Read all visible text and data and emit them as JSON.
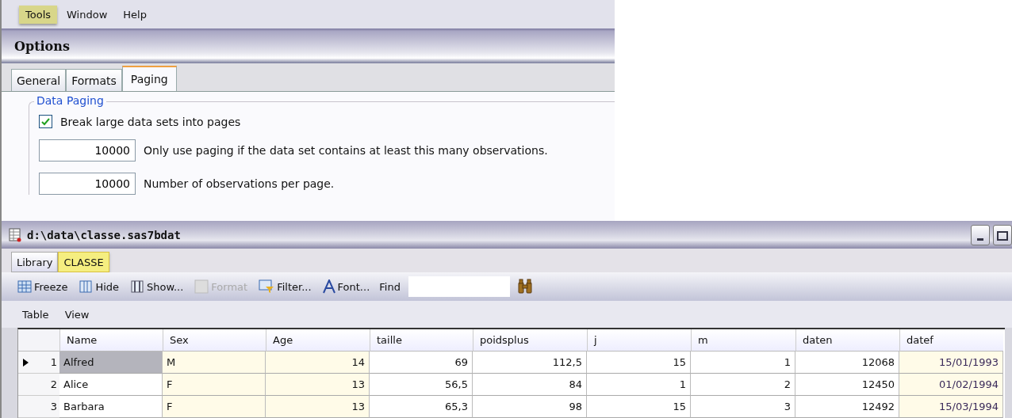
{
  "menu": [
    {
      "label": "Tools",
      "selected": true
    },
    {
      "label": "Window",
      "selected": false
    },
    {
      "label": "Help",
      "selected": false
    }
  ],
  "options": {
    "title": "Options",
    "tabs": [
      {
        "label": "General",
        "selected": false
      },
      {
        "label": "Formats",
        "selected": false
      },
      {
        "label": "Paging",
        "selected": true
      }
    ],
    "group": "Data Paging",
    "checkbox": {
      "label": "Break large data sets into pages",
      "checked": true
    },
    "fields": [
      {
        "value": "10000",
        "label": "Only use paging if the data set contains at least this many observations."
      },
      {
        "value": "10000",
        "label": "Number of observations per page."
      }
    ]
  },
  "viewer": {
    "title": "d:\\data\\classe.sas7bdat",
    "tabs": [
      {
        "label": "Library",
        "selected": false
      },
      {
        "label": "CLASSE",
        "selected": true
      }
    ],
    "toolbar": [
      {
        "kind": "freeze",
        "label": "Freeze",
        "disabled": false
      },
      {
        "kind": "hide",
        "label": "Hide",
        "disabled": false
      },
      {
        "kind": "show",
        "label": "Show...",
        "disabled": false
      },
      {
        "kind": "format",
        "label": "Format",
        "disabled": true
      },
      {
        "kind": "filter",
        "label": "Filter...",
        "disabled": false
      },
      {
        "kind": "font",
        "label": "Font...",
        "disabled": false
      }
    ],
    "find_label": "Find",
    "menu": [
      "Table",
      "View"
    ],
    "table": {
      "columns": [
        {
          "label": "Name",
          "tinted": false
        },
        {
          "label": "Sex",
          "tinted": true
        },
        {
          "label": "Age",
          "tinted": true
        },
        {
          "label": "taille",
          "tinted": false
        },
        {
          "label": "poidsplus",
          "tinted": false
        },
        {
          "label": "j",
          "tinted": false
        },
        {
          "label": "m",
          "tinted": false
        },
        {
          "label": "daten",
          "tinted": false
        },
        {
          "label": "datef",
          "tinted": true
        }
      ],
      "rows": [
        {
          "number": "1",
          "selected": true,
          "cells": [
            "Alfred",
            "M",
            "14",
            "69",
            "112,5",
            "15",
            "1",
            "12068",
            "15/01/1993"
          ]
        },
        {
          "number": "2",
          "selected": false,
          "cells": [
            "Alice",
            "F",
            "13",
            "56,5",
            "84",
            "1",
            "2",
            "12450",
            "01/02/1994"
          ]
        },
        {
          "number": "3",
          "selected": false,
          "cells": [
            "Barbara",
            "F",
            "13",
            "65,3",
            "98",
            "15",
            "3",
            "12492",
            "15/03/1994"
          ]
        }
      ]
    }
  }
}
